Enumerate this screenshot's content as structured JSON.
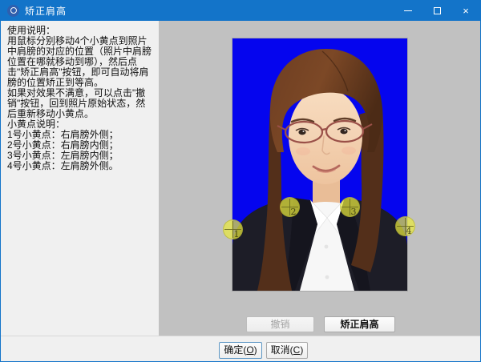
{
  "window": {
    "title": "矫正肩高",
    "icons": {
      "app": "camera-lens-icon",
      "minimize": "─",
      "maximize": "□",
      "close": "×"
    }
  },
  "instructions": {
    "heading": "使用说明：",
    "para1": "用鼠标分别移动4个小黄点到照片中肩膀的对应的位置（照片中肩膀位置在哪就移动到哪），然后点击\"矫正肩高\"按钮，即可自动将肩膀的位置矫正到等高。",
    "para2": "如果对效果不满意，可以点击\"撤销\"按钮，回到照片原始状态，然后重新移动小黄点。",
    "dots_heading": "小黄点说明：",
    "dot_lines": [
      "1号小黄点：右肩膀外侧；",
      "2号小黄点：右肩膀内侧；",
      "3号小黄点：左肩膀内侧；",
      "4号小黄点：左肩膀外侧。"
    ]
  },
  "photo_tools": {
    "undo_label": "撤销",
    "correct_label": "矫正肩高"
  },
  "markers": [
    {
      "number": "1"
    },
    {
      "number": "2"
    },
    {
      "number": "3"
    },
    {
      "number": "4"
    }
  ],
  "dialog_buttons": {
    "ok": {
      "prefix": "确定(",
      "key": "O",
      "suffix": ")"
    },
    "cancel": {
      "prefix": "取消(",
      "key": "C",
      "suffix": ")"
    }
  },
  "colors": {
    "titlebar": "#1374c9",
    "photo_background_blue": "#0505ee",
    "viewer_background": "#c1c1c1",
    "panel_background": "#f0f0f0",
    "marker_yellow": "#e9e93e"
  }
}
